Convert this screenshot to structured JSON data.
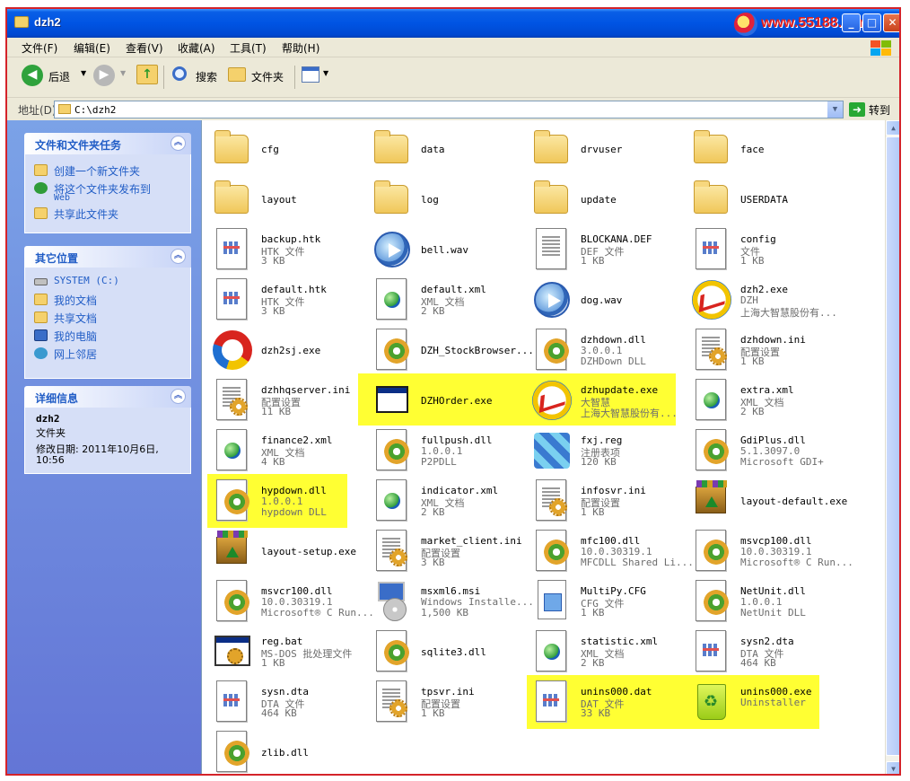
{
  "window": {
    "title": "dzh2",
    "watermark": "www.55188.com"
  },
  "menu": [
    {
      "label": "文件(F)"
    },
    {
      "label": "编辑(E)"
    },
    {
      "label": "查看(V)"
    },
    {
      "label": "收藏(A)"
    },
    {
      "label": "工具(T)"
    },
    {
      "label": "帮助(H)"
    }
  ],
  "toolbar": {
    "back": "后退",
    "search": "搜索",
    "folders": "文件夹"
  },
  "address": {
    "label": "地址(D)",
    "path": "C:\\dzh2",
    "go": "转到"
  },
  "sidebar": {
    "tasks": {
      "title": "文件和文件夹任务",
      "items": [
        {
          "label": "创建一个新文件夹",
          "icon": "new-folder-icon"
        },
        {
          "label": "将这个文件夹发布到",
          "label2": "Web",
          "icon": "publish-web-icon"
        },
        {
          "label": "共享此文件夹",
          "icon": "share-folder-icon"
        }
      ]
    },
    "places": {
      "title": "其它位置",
      "items": [
        {
          "label": "SYSTEM (C:)",
          "icon": "drive-icon"
        },
        {
          "label": "我的文档",
          "icon": "my-documents-icon"
        },
        {
          "label": "共享文档",
          "icon": "shared-documents-icon"
        },
        {
          "label": "我的电脑",
          "icon": "my-computer-icon"
        },
        {
          "label": "网上邻居",
          "icon": "network-places-icon"
        }
      ]
    },
    "details": {
      "title": "详细信息",
      "name": "dzh2",
      "type": "文件夹",
      "modified": "修改日期: 2011年10月6日,",
      "modified_time": "10:56"
    }
  },
  "files": [
    {
      "name": "cfg",
      "icon": "folder"
    },
    {
      "name": "data",
      "icon": "folder"
    },
    {
      "name": "drvuser",
      "icon": "folder"
    },
    {
      "name": "face",
      "icon": "folder"
    },
    {
      "name": "layout",
      "icon": "folder"
    },
    {
      "name": "log",
      "icon": "folder"
    },
    {
      "name": "update",
      "icon": "folder"
    },
    {
      "name": "USERDATA",
      "icon": "folder"
    },
    {
      "name": "backup.htk",
      "l1": "HTK 文件",
      "l2": "3 KB",
      "icon": "grid-doc"
    },
    {
      "name": "bell.wav",
      "icon": "media"
    },
    {
      "name": "BLOCKANA.DEF",
      "l1": "DEF 文件",
      "l2": "1 KB",
      "icon": "text-doc"
    },
    {
      "name": "config",
      "l1": "文件",
      "l2": "1 KB",
      "icon": "grid-doc"
    },
    {
      "name": "default.htk",
      "l1": "HTK 文件",
      "l2": "3 KB",
      "icon": "grid-doc"
    },
    {
      "name": "default.xml",
      "l1": "XML 文档",
      "l2": "2 KB",
      "icon": "xml-doc"
    },
    {
      "name": "dog.wav",
      "icon": "media"
    },
    {
      "name": "dzh2.exe",
      "l1": "DZH",
      "l2": "上海大智慧股份有...",
      "icon": "dzh"
    },
    {
      "name": "dzh2sj.exe",
      "icon": "dzhsj"
    },
    {
      "name": "DZH_StockBrowser...",
      "icon": "dll"
    },
    {
      "name": "dzhdown.dll",
      "l1": "3.0.0.1",
      "l2": "DZHDown DLL",
      "icon": "dll"
    },
    {
      "name": "dzhdown.ini",
      "l1": "配置设置",
      "l2": "1 KB",
      "icon": "ini"
    },
    {
      "name": "dzhhqserver.ini",
      "l1": "配置设置",
      "l2": "11 KB",
      "icon": "ini"
    },
    {
      "name": "DZHOrder.exe",
      "icon": "appwin"
    },
    {
      "name": "dzhupdate.exe",
      "l1": "大智慧",
      "l2": "上海大智慧股份有...",
      "icon": "dzh"
    },
    {
      "name": "extra.xml",
      "l1": "XML 文档",
      "l2": "2 KB",
      "icon": "xml-doc"
    },
    {
      "name": "finance2.xml",
      "l1": "XML 文档",
      "l2": "4 KB",
      "icon": "xml-doc"
    },
    {
      "name": "fullpush.dll",
      "l1": "1.0.0.1",
      "l2": "P2PDLL",
      "icon": "dll"
    },
    {
      "name": "fxj.reg",
      "l1": "注册表项",
      "l2": "120 KB",
      "icon": "reg"
    },
    {
      "name": "GdiPlus.dll",
      "l1": "5.1.3097.0",
      "l2": "Microsoft GDI+",
      "icon": "dll"
    },
    {
      "name": "hypdown.dll",
      "l1": "1.0.0.1",
      "l2": "hypdown DLL",
      "icon": "dll"
    },
    {
      "name": "indicator.xml",
      "l1": "XML 文档",
      "l2": "2 KB",
      "icon": "xml-doc"
    },
    {
      "name": "infosvr.ini",
      "l1": "配置设置",
      "l2": "1 KB",
      "icon": "ini"
    },
    {
      "name": "layout-default.exe",
      "icon": "box"
    },
    {
      "name": "layout-setup.exe",
      "icon": "box"
    },
    {
      "name": "market_client.ini",
      "l1": "配置设置",
      "l2": "3 KB",
      "icon": "ini"
    },
    {
      "name": "mfc100.dll",
      "l1": "10.0.30319.1",
      "l2": "MFCDLL Shared Li...",
      "icon": "dll"
    },
    {
      "name": "msvcp100.dll",
      "l1": "10.0.30319.1",
      "l2": "Microsoft® C Run...",
      "icon": "dll"
    },
    {
      "name": "msvcr100.dll",
      "l1": "10.0.30319.1",
      "l2": "Microsoft® C Run...",
      "icon": "dll"
    },
    {
      "name": "msxml6.msi",
      "l1": "Windows Installe...",
      "l2": "1,500 KB",
      "icon": "msi"
    },
    {
      "name": "MultiPy.CFG",
      "l1": "CFG 文件",
      "l2": "1 KB",
      "icon": "cfg"
    },
    {
      "name": "NetUnit.dll",
      "l1": "1.0.0.1",
      "l2": "NetUnit DLL",
      "icon": "dll"
    },
    {
      "name": "reg.bat",
      "l1": "MS-DOS 批处理文件",
      "l2": "1 KB",
      "icon": "bat"
    },
    {
      "name": "sqlite3.dll",
      "icon": "dll"
    },
    {
      "name": "statistic.xml",
      "l1": "XML 文档",
      "l2": "2 KB",
      "icon": "xml-doc"
    },
    {
      "name": "sysn2.dta",
      "l1": "DTA 文件",
      "l2": "464 KB",
      "icon": "grid-doc"
    },
    {
      "name": "sysn.dta",
      "l1": "DTA 文件",
      "l2": "464 KB",
      "icon": "grid-doc"
    },
    {
      "name": "tpsvr.ini",
      "l1": "配置设置",
      "l2": "1 KB",
      "icon": "ini"
    },
    {
      "name": "unins000.dat",
      "l1": "DAT 文件",
      "l2": "33 KB",
      "icon": "grid-doc"
    },
    {
      "name": "unins000.exe",
      "l1": "Uninstaller",
      "icon": "bin"
    },
    {
      "name": "zlib.dll",
      "icon": "dll"
    }
  ]
}
